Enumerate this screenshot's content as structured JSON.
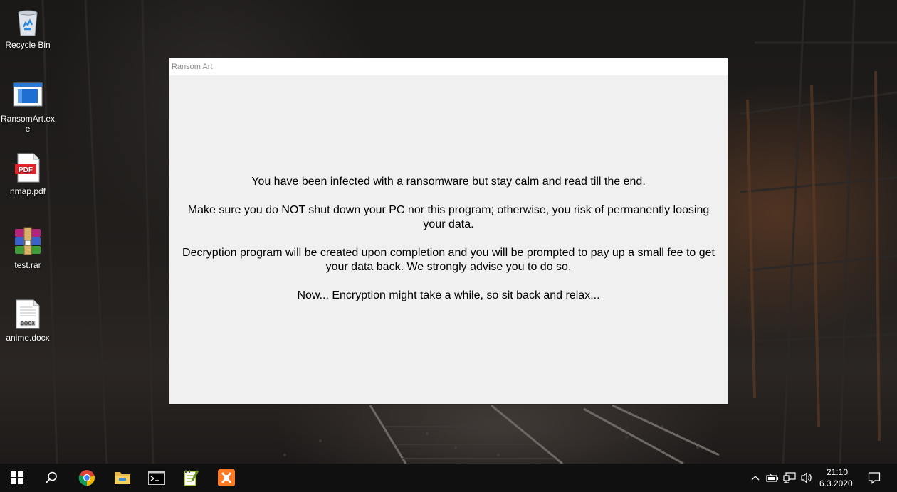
{
  "desktop": {
    "icons": [
      {
        "label": "Recycle Bin"
      },
      {
        "label": "RansomArt.exe"
      },
      {
        "label": "nmap.pdf",
        "badge": "PDF"
      },
      {
        "label": "test.rar"
      },
      {
        "label": "anime.docx",
        "badge": "DOCX"
      }
    ]
  },
  "window": {
    "title": "Ransom Art",
    "messages": [
      "You have been infected with a ransomware but stay calm and read till the end.",
      "Make sure you do NOT shut down your PC nor this program; otherwise, you risk of permanently loosing your data.",
      "Decryption program will be created upon completion and you will be prompted to pay up a small fee to get your data back. We strongly advise you to do so.",
      "Now... Encryption might take a while, so sit back and relax..."
    ]
  },
  "taskbar": {
    "pinned": [
      "start-icon",
      "search-icon",
      "chrome-icon",
      "file-explorer-icon",
      "command-prompt-icon",
      "notepad-plus-plus-icon",
      "xampp-icon"
    ],
    "tray": [
      "chevron-up-icon",
      "battery-icon",
      "network-icon",
      "volume-icon"
    ],
    "clock": {
      "time": "21:10",
      "date": "6.3.2020."
    }
  },
  "colors": {
    "window_bg": "#f0f0f0",
    "titlebar_bg": "#ffffff",
    "taskbar_bg": "#101010"
  }
}
